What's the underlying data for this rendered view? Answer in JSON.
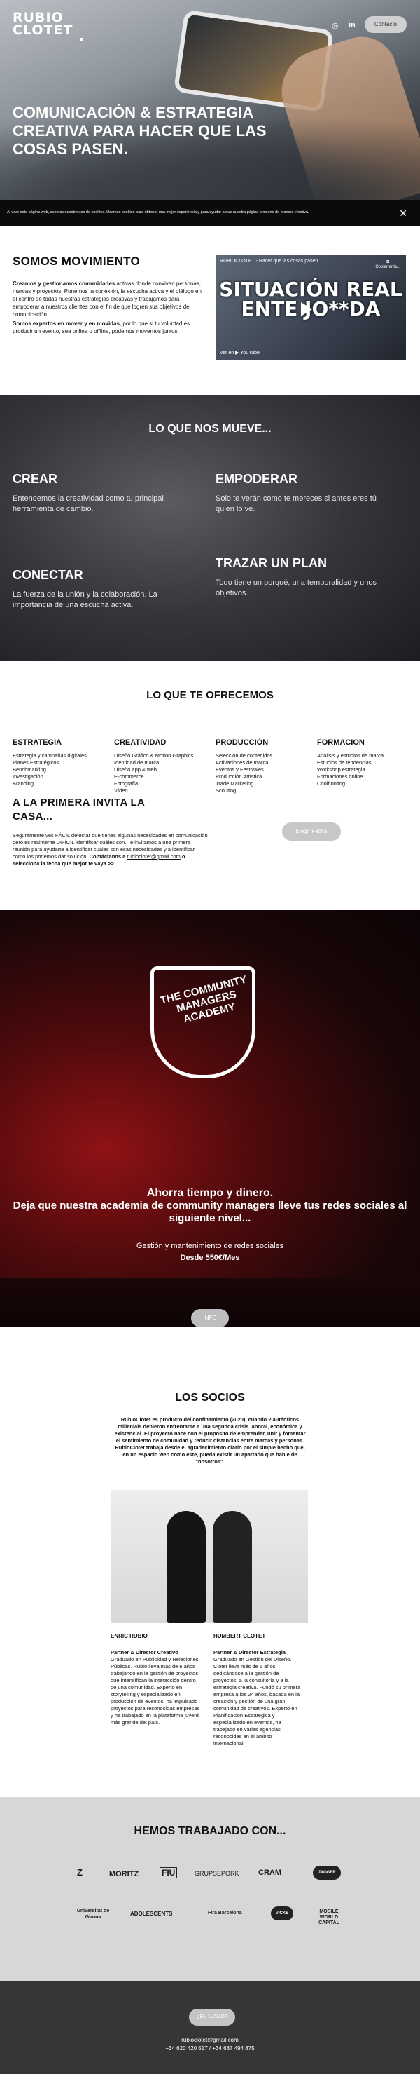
{
  "header": {
    "logo": "RUBIO CLOTET",
    "social": [
      "instagram",
      "linkedin"
    ],
    "contact_label": "Contacto"
  },
  "hero": {
    "title": "Comunicación & estrategia creativa para hacer que las cosas pasen."
  },
  "cookie": {
    "text": "Al usar esta página web, aceptas nuestro uso de cookies. Usamos cookies para obtener una mejor experiencia y para ayudar a que nuestra página funcione de manera efectiva.",
    "close": "✕"
  },
  "somos": {
    "title": "SOMOS MOVIMIENTO",
    "p1_bold": "Creamos y gestionamos comunidades",
    "p1": " activas donde convivan personas, marcas y proyectos. Ponemos la conexión, la escucha activa y el diálogo en el centro de todas nuestras estrategias creativas y trabajamos para empoderar a nuestros clientes con el fin de que logren sus objetivos de comunicación.",
    "p2_bold": "Somos expertos en mover y en movidas",
    "p2": ", por lo que si tu voluntad es producir un evento, sea online u offline, ",
    "p2_link": "podemos movernos juntos.",
    "video": {
      "channel": "RUBIOCLOTET - Hacer que las cosas pasen",
      "share": "Copiar enla...",
      "title": "SITUACIÓN REAL ENTE JO**DA",
      "watch": "Ver en ▶ YouTube"
    }
  },
  "mueve": {
    "title": "LO QUE NOS MUEVE...",
    "items": [
      {
        "title": "CREAR",
        "text": "Entendemos la creatividad como tu principal herramienta de cambio."
      },
      {
        "title": "EMPODERAR",
        "text": "Solo te verán como te mereces si antes eres tú quien lo ve."
      },
      {
        "title": "CONECTAR",
        "text": "La fuerza de la unión y la colaboración. La importancia de una escucha activa."
      },
      {
        "title": "TRAZAR UN PLAN",
        "text": "Todo tiene un porqué, una temporalidad y unos objetivos."
      }
    ]
  },
  "ofrecemos": {
    "title": "LO QUE TE OFRECEMOS",
    "columns": [
      {
        "title": "ESTRATEGIA",
        "items": [
          "Estrategia y campañas digitales",
          "Planes Estratégicos",
          "Benchmarking",
          "Investigación",
          "Branding"
        ]
      },
      {
        "title": "CREATIVIDAD",
        "items": [
          "Diseño Gráfico & Motion Graphics",
          "Identidad de marca",
          "Diseño app & web",
          "E-commerce",
          "Fotografía",
          "Vídeo"
        ]
      },
      {
        "title": "PRODUCCIÓN",
        "items": [
          "Selección de contenidos",
          "Activaciones de marca",
          "Eventos y Festivales",
          "Producción Artística",
          "Trade Marketing",
          "Scouting"
        ]
      },
      {
        "title": "FORMACIÓN",
        "items": [
          "Análisis y estudios de marca",
          "Estudios de tendencias",
          "Workshop estrategia",
          "Formaciones online",
          "Coolhunting"
        ]
      }
    ],
    "cita_title": "A LA PRIMERA INVITA LA CASA...",
    "cita_text": "Seguramente ves FÁCIL detectar que tienes algunas necesidades en comunicación pero es realmente DIFÍCIL identificar cuáles son. Te invitamos a una primera reunión para ayudarte a identificar cuáles son esas necesidades y a identificar cómo los podemos dar solución. ",
    "cita_contact": "Contáctanos  a ",
    "cita_mail": "rubioclotet@gmail.com",
    "cita_end": " o selecciona la fecha que mejor te vaya >>",
    "cita_button": "Elegir Fecha"
  },
  "academy": {
    "logo_text": "THE COMMUNITY MANAGERS ACADEMY",
    "line1": "Ahorra tiempo y dinero.",
    "line2": "Deja que nuestra academia de community managers lleve tus  redes sociales al siguiente nivel...",
    "line3": "Gestión y mantenimiento de redes sociales",
    "line4": "Desde 550€/Mes",
    "button": "INFO"
  },
  "socios": {
    "title": "LOS SOCIOS",
    "intro": "RubioClotet es producto del confinamiento (2020), cuando 2 auténticos millenials debieron enfrentarse a una segunda crisis laboral, económica y existencial. El proyecto nace con el propósito de emprender, unir y fomentar el sentimiento de comunidad y reducir distancias entre marcas y personas. RubioClotet trabaja desde el agradecimiento diario por el simple hecho que, en un espacio web como este, pueda existir un apartado que hable de \"nosotros\".",
    "partners": [
      {
        "name": "ENRIC RUBIO",
        "role": "Partner & Director Creativo",
        "bio": "Graduado en Publicidad y Relaciones Públicas. Rubio lleva más de 6 años trabajando en la gestión de proyectos que intensifican la interacción dentro de una comunidad. Experto en storytelling y especializado en producción de eventos, ha impulsado proyectos para reconocidas empresas y ha trabajado en la plataforma juvenil más grande del país."
      },
      {
        "name": "HUMBERT CLOTET",
        "role": "Partner & Director Estrategia",
        "bio": "Graduado en Gestión del Diseño. Clotet lleva más de 6 años dedicándose a la gestión de proyectos, a la consultoría y a la estrategia creativa. Fundó su primera empresa a los 24 años, basada en la creación y gestión de una gran comunidad de creativos. Experto en Planificación Estratégica y especializado en eventos, ha trabajado en varias agencias reconocidas en el ámbito internacional."
      }
    ]
  },
  "trabajado": {
    "title": "HEMOS TRABAJADO CON...",
    "brands": [
      "Z",
      "MORITZ",
      "FIU",
      "GRUPSEPORK",
      "CRAM",
      "JAGGER",
      "Universitat de Girona",
      "ADOLESCENTS",
      "Fira Barcelona",
      "VICKS",
      "MOBILE WORLD CAPITAL"
    ]
  },
  "footer": {
    "button": "¿EN LLAMO?",
    "mail": "rubioclotet@gmail.com",
    "phones": "+34 620 420 517 / +34 687 494 875"
  },
  "colors": {
    "accent_red": "#8f1216",
    "footer_bg": "#363638",
    "brand_bg": "#d5d7d9"
  }
}
